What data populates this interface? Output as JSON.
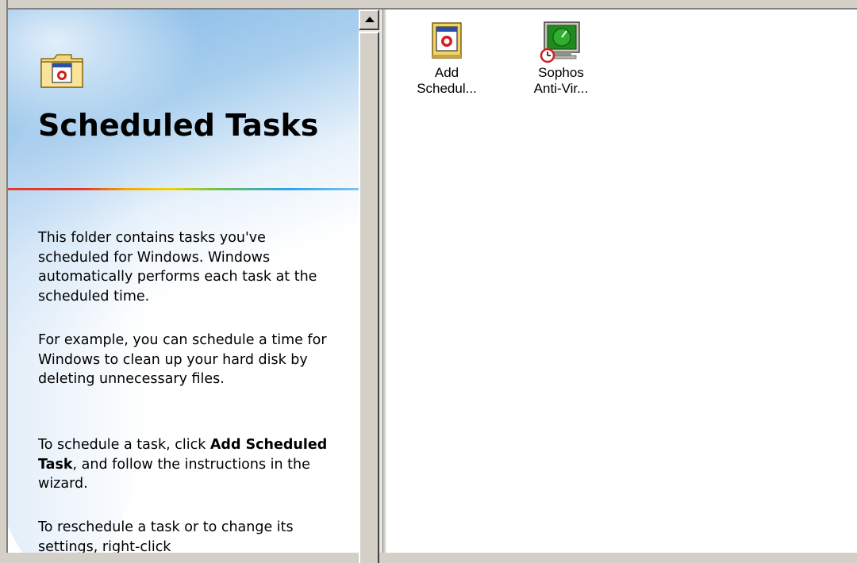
{
  "info_pane": {
    "title": "Scheduled Tasks",
    "paragraphs": {
      "p1": "This folder contains tasks you've scheduled for Windows. Windows automatically performs each task at the scheduled time.",
      "p2": "For example, you can schedule a time for Windows to clean up your hard disk by deleting unnecessary files.",
      "p3_before": "To schedule a task, click ",
      "p3_bold": "Add Scheduled Task",
      "p3_after": ", and follow the instructions in the wizard.",
      "p4": "To reschedule a task or to change its settings, right-click"
    },
    "icon": "scheduled-tasks-folder-icon"
  },
  "files": [
    {
      "label_line1": "Add",
      "label_line2": "Schedul...",
      "icon": "add-scheduled-task-icon"
    },
    {
      "label_line1": "Sophos",
      "label_line2": "Anti-Vir...",
      "icon": "sophos-antivirus-task-icon"
    }
  ],
  "colors": {
    "window_face": "#d4d0c8",
    "accent_red": "#e23a2a",
    "monitor_green": "#1f8a1f"
  }
}
